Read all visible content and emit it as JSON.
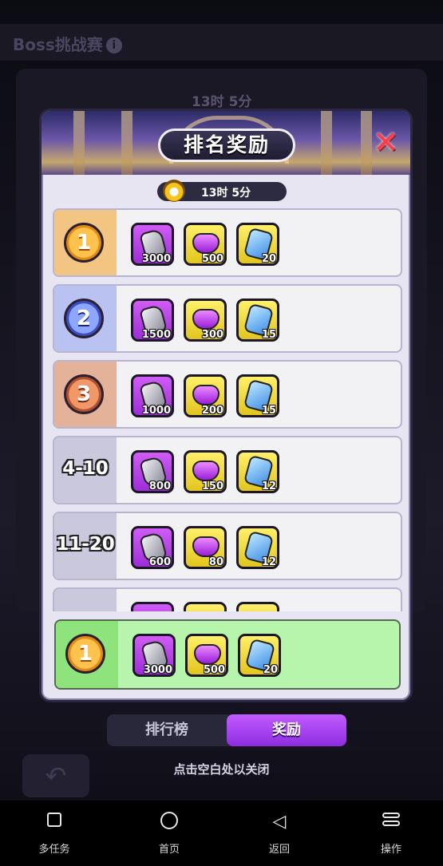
{
  "background": {
    "title": "Boss挑战赛",
    "timer": "13时 5分"
  },
  "modal": {
    "title": "排名奖励",
    "close_icon": "close-x-icon",
    "timer": "13时 5分",
    "rows": [
      {
        "rank": "1",
        "kind": "gold",
        "rewards": [
          "3000",
          "500",
          "20"
        ]
      },
      {
        "rank": "2",
        "kind": "silver",
        "rewards": [
          "1500",
          "300",
          "15"
        ]
      },
      {
        "rank": "3",
        "kind": "bronze",
        "rewards": [
          "1000",
          "200",
          "15"
        ]
      },
      {
        "rank": "4-10",
        "kind": "text",
        "rewards": [
          "800",
          "150",
          "12"
        ]
      },
      {
        "rank": "11-20",
        "kind": "text",
        "rewards": [
          "600",
          "80",
          "12"
        ]
      }
    ],
    "my_row": {
      "rank": "1",
      "rewards": [
        "3000",
        "500",
        "20"
      ]
    }
  },
  "tabs": {
    "leaderboard": "排行榜",
    "rewards": "奖励",
    "active": "rewards"
  },
  "hint": "点击空白处以关闭",
  "system_nav": {
    "multitask": "多任务",
    "home": "首页",
    "back": "返回",
    "operate": "操作"
  },
  "colors": {
    "purple_item": "#b845ea",
    "yellow_item": "#f3dc3a",
    "my_row_bg": "#b6f5ab",
    "active_tab": "#a846f0"
  }
}
